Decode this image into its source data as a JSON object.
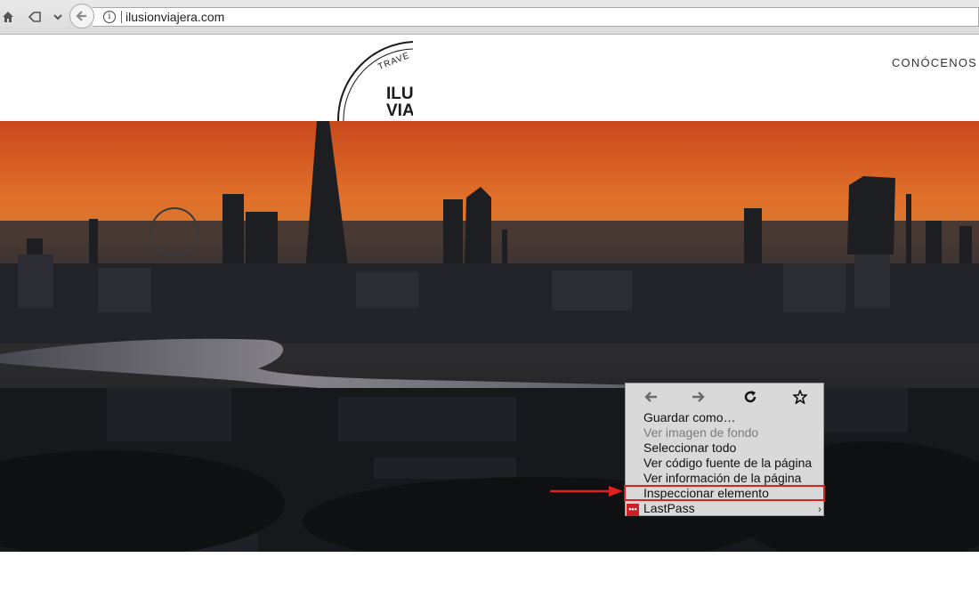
{
  "browser": {
    "url": "ilusionviajera.com",
    "info_glyph": "i"
  },
  "site": {
    "logo": {
      "arc_text": "TRAVE",
      "line1": "ILUS",
      "line2": "VIAJ"
    },
    "nav": {
      "link": "CONÓCENOS"
    }
  },
  "context_menu": {
    "nav_icons": [
      "back-arrow-icon",
      "forward-arrow-icon",
      "reload-icon",
      "bookmark-star-icon"
    ],
    "items": [
      {
        "label": "Guardar como…",
        "enabled": true
      },
      {
        "label": "Ver imagen de fondo",
        "enabled": false
      },
      {
        "label": "Seleccionar todo",
        "enabled": true
      },
      {
        "label": "Ver código fuente de la página",
        "enabled": true
      },
      {
        "label": "Ver información de la página",
        "enabled": true
      },
      {
        "label": "Inspeccionar elemento",
        "enabled": true,
        "highlighted": true
      },
      {
        "label": "LastPass",
        "enabled": true,
        "has_submenu": true
      }
    ],
    "lastpass_icon_text": "•••"
  },
  "colors": {
    "highlight": "#e21e1e",
    "sky_top": "#d4521f",
    "sky_glow": "#f08a2e",
    "menu_bg": "#d9d9d9"
  }
}
